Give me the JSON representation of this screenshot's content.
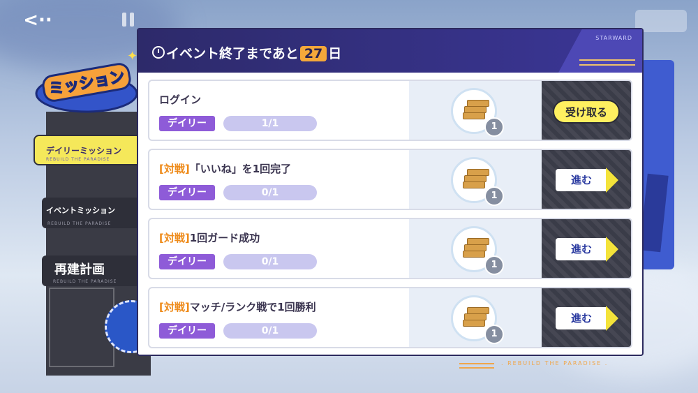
{
  "header": {
    "title_before": "イベント終了まであと",
    "days": "27",
    "title_after": "日",
    "brand": "STARWARD"
  },
  "sidebar": {
    "logo_text": "ミッション",
    "items": [
      {
        "label": "デイリーミッション",
        "sub": "REBUILD THE PARADISE"
      },
      {
        "label": "イベントミッション",
        "sub": "REBUILD THE PARADISE"
      },
      {
        "label": "再建計画",
        "sub": "REBUILD THE PARADISE"
      }
    ]
  },
  "missions": [
    {
      "tag": "",
      "title": "ログイン",
      "category": "デイリー",
      "progress": "1/1",
      "reward_count": "1",
      "action": "受け取る",
      "action_type": "claim"
    },
    {
      "tag": "[対戦]",
      "title": "「いいね」を1回完了",
      "category": "デイリー",
      "progress": "0/1",
      "reward_count": "1",
      "action": "進む",
      "action_type": "go"
    },
    {
      "tag": "[対戦]",
      "title": "1回ガード成功",
      "category": "デイリー",
      "progress": "0/1",
      "reward_count": "1",
      "action": "進む",
      "action_type": "go"
    },
    {
      "tag": "[対戦]",
      "title": "マッチ/ランク戦で1回勝利",
      "category": "デイリー",
      "progress": "0/1",
      "reward_count": "1",
      "action": "進む",
      "action_type": "go"
    }
  ],
  "footer": {
    "text": ". REBUILD THE PARADISE ."
  },
  "colors": {
    "accent": "#f4a83a",
    "header": "#2d2a6a",
    "claim": "#fff060",
    "tag": "#ee8a19",
    "daily": "#8e5bd8"
  },
  "icons": {
    "back": "back-arrow-icon",
    "timer": "timer-icon",
    "reward": "wood-planks-icon",
    "arrow": "arrow-right-icon"
  }
}
